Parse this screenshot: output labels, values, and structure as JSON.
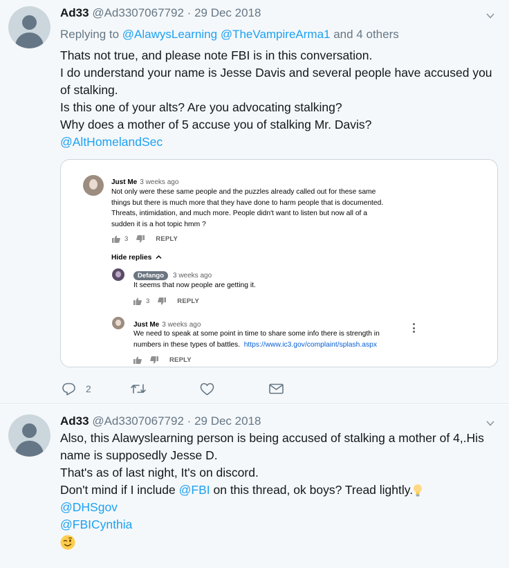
{
  "tweets": [
    {
      "name": "Ad33",
      "handle": "@Ad3307067792",
      "separator": "·",
      "date": "29 Dec 2018",
      "replying_prefix": "Replying to",
      "replying_users": [
        "@AlawysLearning",
        "@TheVampireArma1"
      ],
      "replying_suffix": "and 4 others",
      "text_lines": [
        "Thats not true, and please note FBI is in this conversation.",
        "I do understand your name is Jesse Davis and several people have accused you",
        "of stalking.",
        "Is this one of your alts? Are you advocating stalking?",
        "Why does a mother of 5 accuse you of stalking Mr. Davis?"
      ],
      "mention_line": "@AltHomelandSec",
      "actions": {
        "reply_count": "2",
        "retweet_count": "",
        "like_count": ""
      }
    },
    {
      "name": "Ad33",
      "handle": "@Ad3307067792",
      "separator": "·",
      "date": "29 Dec 2018",
      "text_lines": [
        "Also, this Alawyslearning person is being accused of stalking a mother of 4,.His",
        "name is supposedly Jesse D.",
        "That's as of last night, It's on discord."
      ],
      "line4_before": "Don't mind if I include ",
      "line4_mention": "@FBI",
      "line4_after": " on this thread, ok boys? Tread lightly.",
      "mentions": [
        "@DHSgov",
        "@FBICynthia"
      ]
    }
  ],
  "embed": {
    "comment1": {
      "author": "Just Me",
      "time": "3 weeks ago",
      "lines": [
        "Not only were these same people and the puzzles already called out for these same",
        "things but there is much more that they have done to harm people that is documented.",
        "Threats, intimidation, and much more. People didn't want to listen but now all of a",
        "sudden it is a hot topic hmm ?"
      ],
      "likes": "3",
      "reply_label": "REPLY"
    },
    "hide_replies": "Hide replies",
    "reply1": {
      "author": "Defango",
      "time": "3 weeks ago",
      "text": "It seems that now people are getting it.",
      "likes": "3",
      "reply_label": "REPLY"
    },
    "reply2": {
      "author": "Just Me",
      "time": "3 weeks ago",
      "line1": "We need to speak at some point in time to share some info there is strength in",
      "line2_text": "numbers in these types of battles.",
      "line2_url": "https://www.ic3.gov/complaint/splash.aspx",
      "reply_label": "REPLY"
    }
  },
  "colors": {
    "tweet_bg": "#f5f8fa",
    "link": "#1da1f2",
    "muted": "#657786",
    "youtube_link": "#065fd4"
  }
}
